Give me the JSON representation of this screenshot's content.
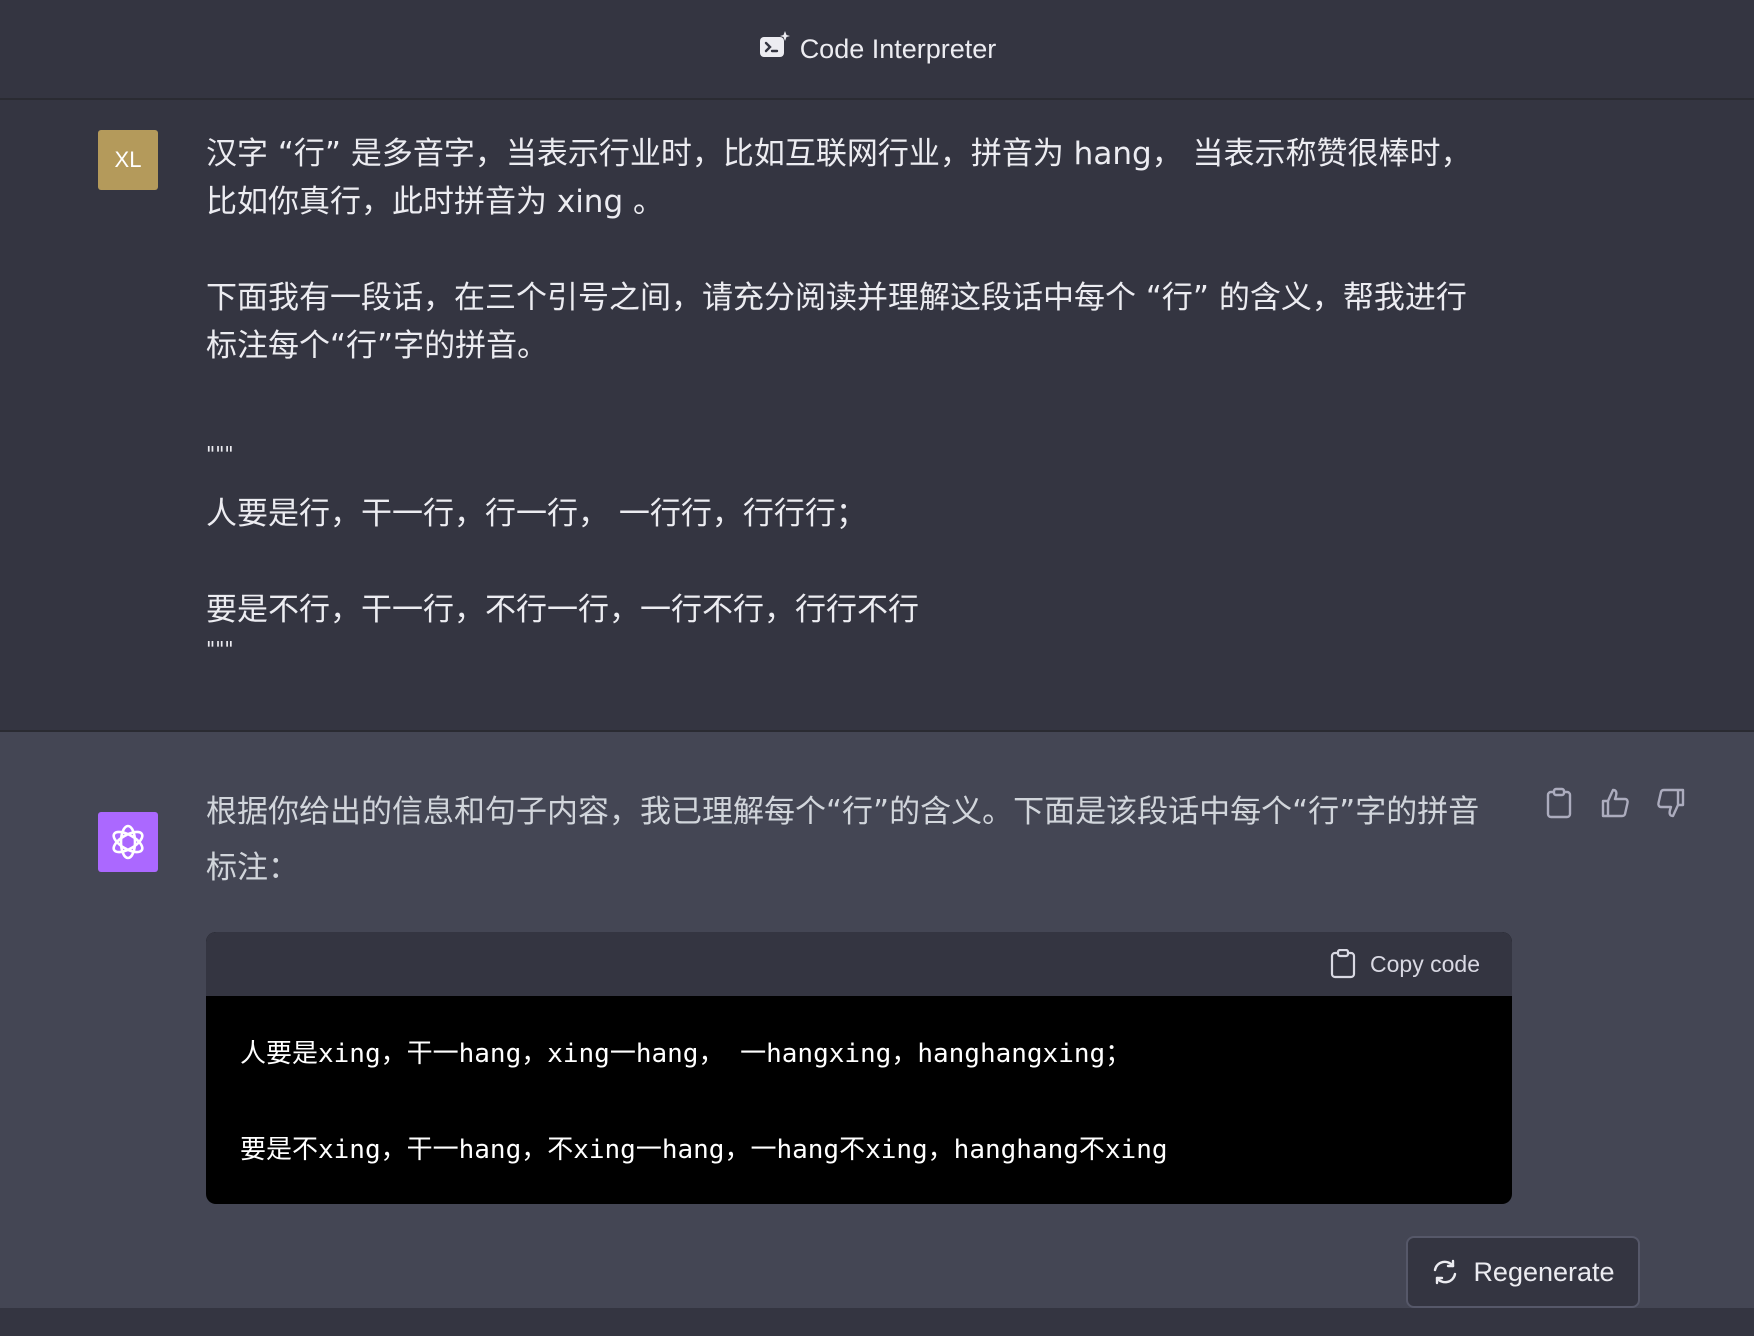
{
  "header": {
    "title": "Code Interpreter",
    "icon": "code-interpreter-icon"
  },
  "user_message": {
    "avatar": "XL",
    "lines": [
      "汉字 “行” 是多音字，当表示行业时，比如互联网行业，拼音为 hang， 当表示称赞很棒时，",
      "比如你真行，此时拼音为 xing 。",
      "下面我有一段话，在三个引号之间，请充分阅读并理解这段话中每个 “行” 的含义，帮我进行",
      "标注每个“行”字的拼音。",
      "\"\"\"",
      "人要是行，干一行，行一行， 一行行，行行行；",
      "要是不行，干一行，不行一行，一行不行，行行不行",
      "\"\"\""
    ]
  },
  "assistant_message": {
    "avatar_icon": "openai-logo-icon",
    "intro_line1": "根据你给出的信息和句子内容，我已理解每个“行”的含义。下面是该段话中每个“行”字的拼音",
    "intro_line2": "标注：",
    "code": {
      "copy_label": "Copy code",
      "lines": [
        "人要是xing，干一hang，xing一hang， 一hangxing，hanghangxing；",
        "要是不xing，干一hang，不xing一hang，一hang不xing，hanghang不xing"
      ]
    }
  },
  "regenerate_label": "Regenerate"
}
